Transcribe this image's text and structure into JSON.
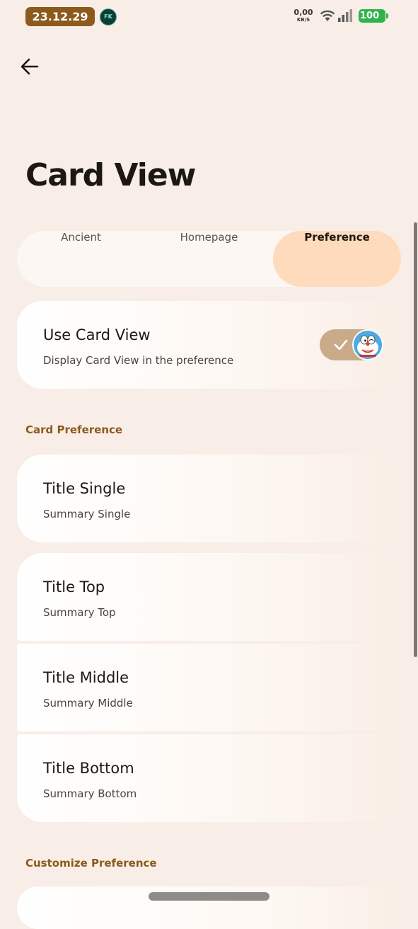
{
  "status_bar": {
    "time": "23.12.29",
    "app_badge": "FK",
    "net_speed": "0,00",
    "net_unit": "KB/S",
    "battery": "100",
    "icons": [
      "wifi-icon",
      "signal-icon",
      "battery-icon"
    ]
  },
  "header": {
    "title": "Card View"
  },
  "tabs": [
    {
      "label": "Ancient",
      "selected": false
    },
    {
      "label": "Homepage",
      "selected": false
    },
    {
      "label": "Preference",
      "selected": true
    }
  ],
  "use_card_view": {
    "title": "Use Card View",
    "summary": "Display Card View in the preference",
    "enabled": true
  },
  "card_preference": {
    "header": "Card Preference",
    "items": [
      {
        "title": "Title Single",
        "summary": "Summary Single"
      },
      {
        "title": "Title Top",
        "summary": "Summary Top"
      },
      {
        "title": "Title Middle",
        "summary": "Summary Middle"
      },
      {
        "title": "Title Bottom",
        "summary": "Summary Bottom"
      }
    ]
  },
  "customize_preference": {
    "header": "Customize Preference"
  },
  "colors": {
    "accent": "#8b5a1c",
    "selected_tab": "#fedbbd",
    "switch_track": "#c9aa89",
    "background": "#f8eee7"
  }
}
